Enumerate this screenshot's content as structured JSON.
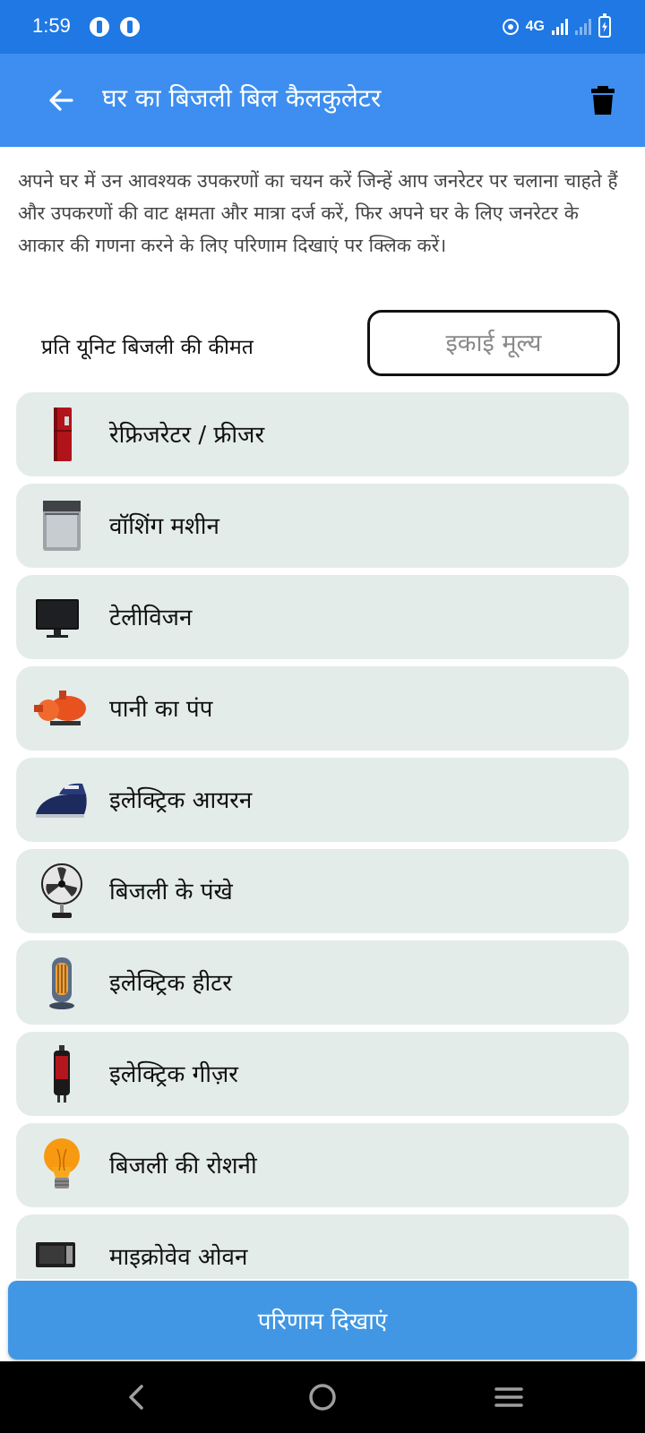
{
  "status_bar": {
    "time": "1:59",
    "network": "4G"
  },
  "app_bar": {
    "title": "घर का बिजली बिल कैलकुलेटर"
  },
  "intro_text": "अपने घर में उन आवश्यक उपकरणों का चयन करें जिन्हें आप जनरेटर पर चलाना चाहते हैं और उपकरणों की वाट क्षमता और मात्रा दर्ज करें, फिर अपने घर के लिए जनरेटर के आकार की गणना करने के लिए परिणाम दिखाएं पर क्लिक करें।",
  "unit_price": {
    "label": "प्रति यूनिट बिजली की कीमत",
    "placeholder": "इकाई मूल्य"
  },
  "appliances": [
    {
      "label": "रेफ्रिजरेटर / फ्रीजर",
      "icon": "refrigerator-icon"
    },
    {
      "label": "वॉशिंग मशीन",
      "icon": "washing-machine-icon"
    },
    {
      "label": "टेलीविजन",
      "icon": "television-icon"
    },
    {
      "label": "पानी का पंप",
      "icon": "water-pump-icon"
    },
    {
      "label": "इलेक्ट्रिक आयरन",
      "icon": "iron-icon"
    },
    {
      "label": "बिजली के पंखे",
      "icon": "fan-icon"
    },
    {
      "label": "इलेक्ट्रिक हीटर",
      "icon": "heater-icon"
    },
    {
      "label": "इलेक्ट्रिक गीज़र",
      "icon": "geyser-icon"
    },
    {
      "label": "बिजली की रोशनी",
      "icon": "light-bulb-icon"
    },
    {
      "label": "माइक्रोवेव ओवन",
      "icon": "microwave-icon"
    }
  ],
  "result_button": {
    "label": "परिणाम दिखाएं"
  },
  "colors": {
    "status_bar": "#1f78e3",
    "app_bar": "#3d8ef0",
    "list_item_bg": "#e4ecea",
    "button": "#4197e3"
  }
}
